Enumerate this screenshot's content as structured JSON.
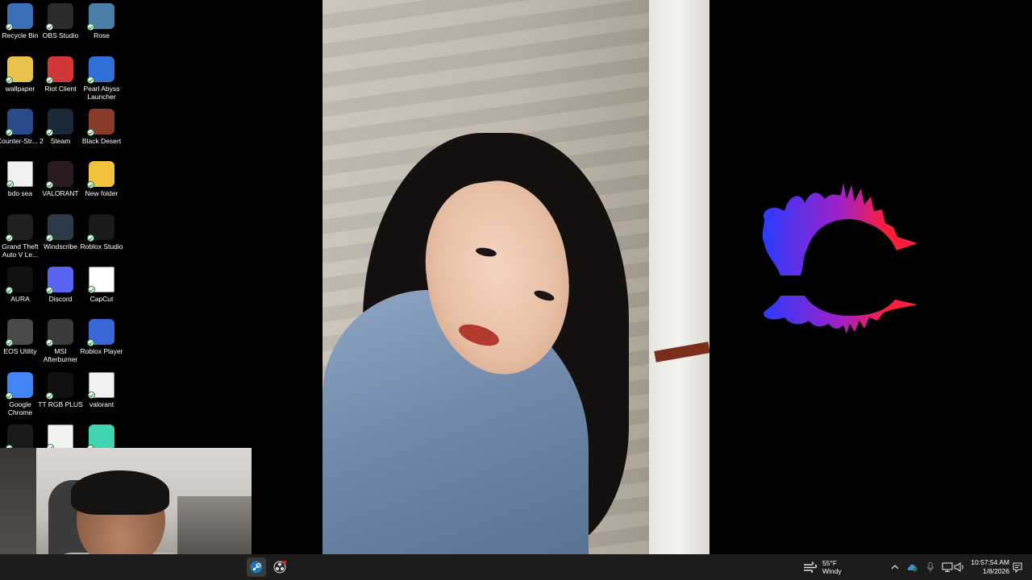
{
  "desktop_icons": [
    {
      "id": "recycle-bin",
      "label": "Recycle Bin",
      "color": "#3b6fb6"
    },
    {
      "id": "obs-studio",
      "label": "OBS Studio",
      "color": "#2b2b2b"
    },
    {
      "id": "rose",
      "label": "Rose",
      "color": "#4a7fa8"
    },
    {
      "id": "wallpaper",
      "label": "wallpaper",
      "color": "#e8c24a"
    },
    {
      "id": "riot-client",
      "label": "Riot Client",
      "color": "#d13639"
    },
    {
      "id": "pearl-abyss-launcher",
      "label": "Pearl Abyss Launcher",
      "color": "#2f6fd6"
    },
    {
      "id": "counter-strike-2",
      "label": "Counter-Str... 2",
      "color": "#2a4a8a"
    },
    {
      "id": "steam",
      "label": "Steam",
      "color": "#1b2838"
    },
    {
      "id": "black-desert",
      "label": "Black Desert",
      "color": "#8a3a2a"
    },
    {
      "id": "bdo-sea",
      "label": "bdo sea",
      "color": "#f2f2f2"
    },
    {
      "id": "valorant",
      "label": "VALORANT",
      "color": "#2a1a22"
    },
    {
      "id": "new-folder",
      "label": "New folder",
      "color": "#f0c33c"
    },
    {
      "id": "gta-v",
      "label": "Grand Theft Auto V Le...",
      "color": "#1f1f1f"
    },
    {
      "id": "windscribe",
      "label": "Windscribe",
      "color": "#2c3a4a"
    },
    {
      "id": "roblox-studio",
      "label": "Roblox Studio",
      "color": "#1a1a1a"
    },
    {
      "id": "aura",
      "label": "AURA",
      "color": "#111111"
    },
    {
      "id": "discord",
      "label": "Discord",
      "color": "#5865f2"
    },
    {
      "id": "capcut",
      "label": "CapCut",
      "color": "#ffffff"
    },
    {
      "id": "eos-utility",
      "label": "EOS Utility",
      "color": "#4a4a4a"
    },
    {
      "id": "msi-afterburner",
      "label": "MSI Afterburner",
      "color": "#3a3a3a"
    },
    {
      "id": "roblox-player",
      "label": "Roblox Player",
      "color": "#3a66d8"
    },
    {
      "id": "google-chrome",
      "label": "Google Chrome",
      "color": "#4285f4"
    },
    {
      "id": "tt-rgb-plus",
      "label": "TT RGB PLUS",
      "color": "#111111"
    },
    {
      "id": "valorant-file",
      "label": "valorant",
      "color": "#f2f2f2"
    },
    {
      "id": "power-app",
      "label": "",
      "color": "#1a1a1a"
    },
    {
      "id": "doc-file",
      "label": "",
      "color": "#f2f2f2"
    },
    {
      "id": "chat-app",
      "label": "",
      "color": "#3dd6b0"
    }
  ],
  "taskbar": {
    "apps": [
      {
        "id": "steam",
        "active": true
      },
      {
        "id": "obs",
        "active": false
      }
    ],
    "weather": {
      "temp": "55°F",
      "condition": "Windy"
    },
    "tray": {
      "chevron": "^"
    },
    "clock": {
      "time": "10:57:54 AM",
      "date": "1/8/2026"
    }
  },
  "colors": {
    "taskbar_bg": "#1c1c1c",
    "visualizer_blue": "#2a3cff",
    "visualizer_red": "#ff1e3c"
  }
}
